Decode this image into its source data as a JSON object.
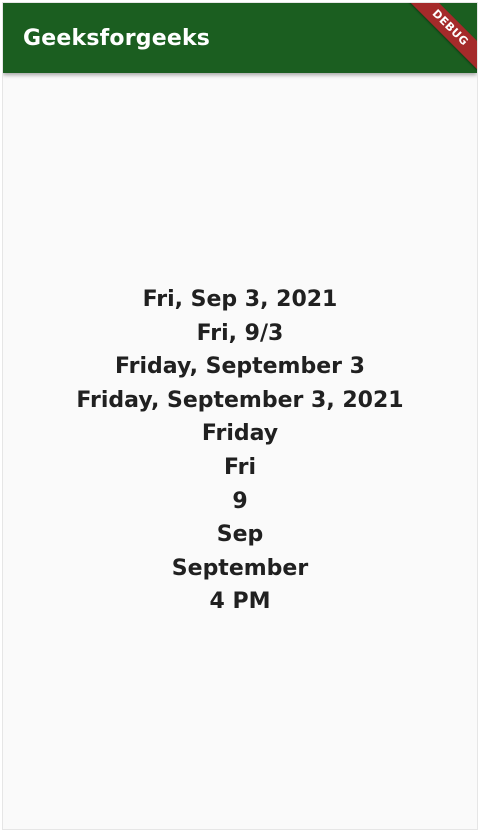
{
  "app_bar": {
    "title": "Geeksforgeeks",
    "color": "#1b5e20"
  },
  "debug_banner": {
    "label": "DEBUG",
    "color": "#a52a2a"
  },
  "date_formats": [
    "Fri, Sep 3, 2021",
    "Fri, 9/3",
    "Friday, September 3",
    "Friday, September 3, 2021",
    "Friday",
    "Fri",
    "9",
    "Sep",
    "September",
    "4 PM"
  ]
}
